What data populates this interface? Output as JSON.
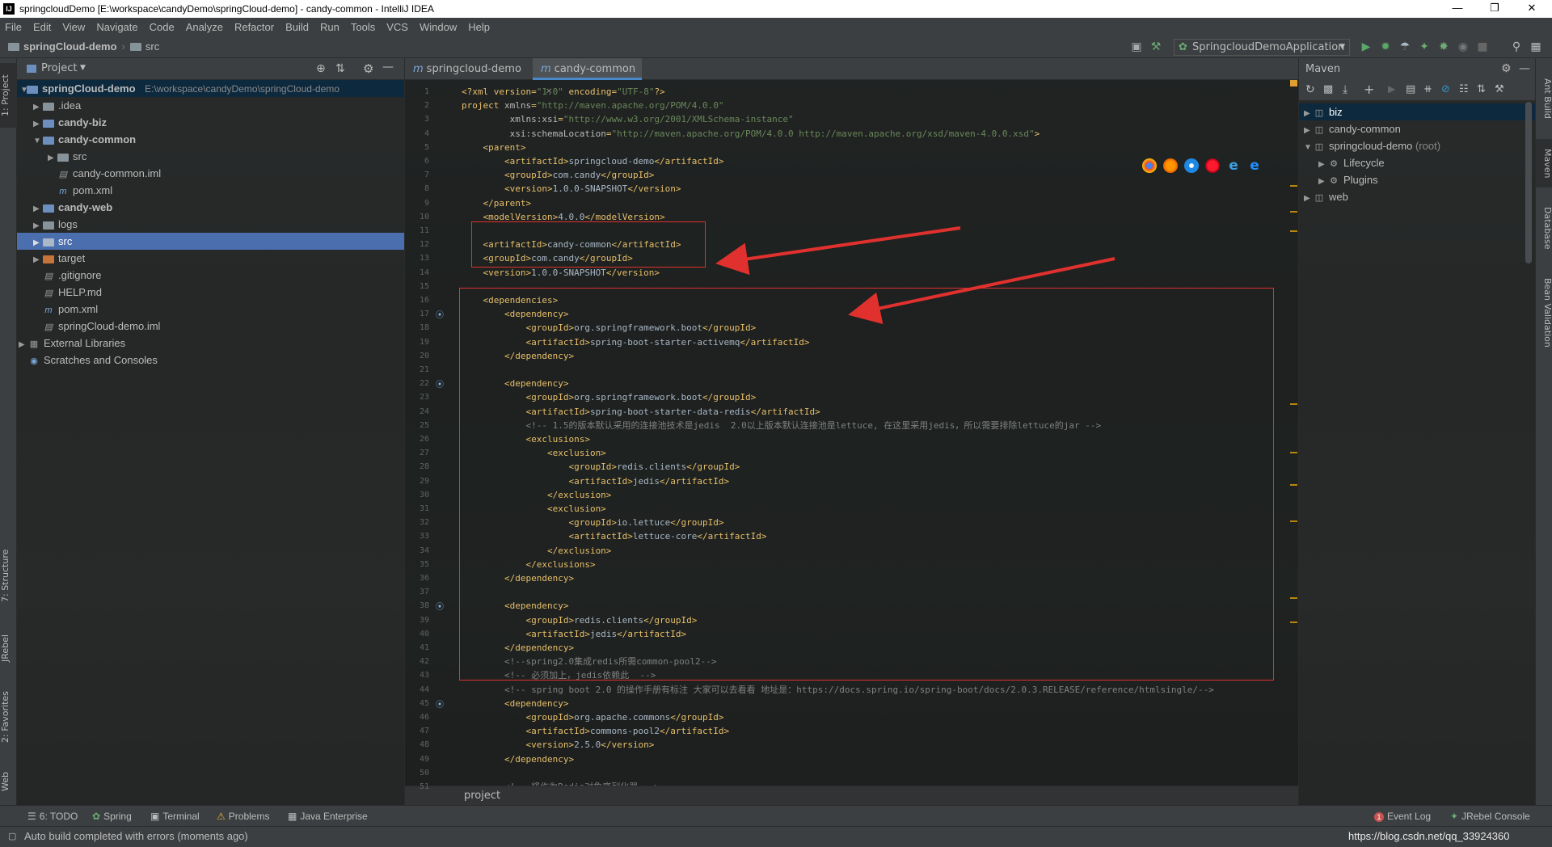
{
  "window": {
    "title": "springcloudDemo [E:\\workspace\\candyDemo\\springCloud-demo] - candy-common - IntelliJ IDEA",
    "app_icon": "IJ"
  },
  "menu": [
    "File",
    "Edit",
    "View",
    "Navigate",
    "Code",
    "Analyze",
    "Refactor",
    "Build",
    "Run",
    "Tools",
    "VCS",
    "Window",
    "Help"
  ],
  "navbar": {
    "root": "springCloud-demo",
    "child": "src",
    "run_config": "SpringcloudDemoApplication"
  },
  "project_panel": {
    "title": "Project",
    "tree": [
      {
        "label": "springCloud-demo",
        "path": "E:\\workspace\\candyDemo\\springCloud-demo",
        "icon": "module-folder-icon",
        "expanded": true
      },
      {
        "label": ".idea",
        "icon": "folder-icon"
      },
      {
        "label": "candy-biz",
        "icon": "module-folder-icon"
      },
      {
        "label": "candy-common",
        "icon": "module-folder-icon",
        "expanded": true
      },
      {
        "label": "src",
        "icon": "folder-icon"
      },
      {
        "label": "candy-common.iml",
        "icon": "iml-file-icon"
      },
      {
        "label": "pom.xml",
        "icon": "maven-file-icon"
      },
      {
        "label": "candy-web",
        "icon": "module-folder-icon"
      },
      {
        "label": "logs",
        "icon": "folder-icon"
      },
      {
        "label": "src",
        "icon": "source-folder-icon",
        "selected": true
      },
      {
        "label": "target",
        "icon": "excluded-folder-icon"
      },
      {
        "label": ".gitignore",
        "icon": "text-file-icon"
      },
      {
        "label": "HELP.md",
        "icon": "markdown-file-icon"
      },
      {
        "label": "pom.xml",
        "icon": "maven-file-icon"
      },
      {
        "label": "springCloud-demo.iml",
        "icon": "iml-file-icon"
      },
      {
        "label": "External Libraries",
        "icon": "library-icon"
      },
      {
        "label": "Scratches and Consoles",
        "icon": "scratch-icon"
      }
    ]
  },
  "editor": {
    "tabs": [
      "springcloud-demo",
      "candy-common"
    ],
    "active_tab": "candy-common",
    "breadcrumb": "project",
    "lines": [
      "<?xml version=\"1.0\" encoding=\"UTF-8\"?>",
      "<project xmlns=\"http://maven.apache.org/POM/4.0.0\"",
      "         xmlns:xsi=\"http://www.w3.org/2001/XMLSchema-instance\"",
      "         xsi:schemaLocation=\"http://maven.apache.org/POM/4.0.0 http://maven.apache.org/xsd/maven-4.0.0.xsd\">",
      "    <parent>",
      "        <artifactId>springcloud-demo</artifactId>",
      "        <groupId>com.candy</groupId>",
      "        <version>1.0.0-SNAPSHOT</version>",
      "    </parent>",
      "    <modelVersion>4.0.0</modelVersion>",
      "",
      "    <artifactId>candy-common</artifactId>",
      "    <groupId>com.candy</groupId>",
      "    <version>1.0.0-SNAPSHOT</version>",
      "",
      "    <dependencies>",
      "        <dependency>",
      "            <groupId>org.springframework.boot</groupId>",
      "            <artifactId>spring-boot-starter-activemq</artifactId>",
      "        </dependency>",
      "",
      "        <dependency>",
      "            <groupId>org.springframework.boot</groupId>",
      "            <artifactId>spring-boot-starter-data-redis</artifactId>",
      "            <!-- 1.5的版本默认采用的连接池技术是jedis  2.0以上版本默认连接池是lettuce, 在这里采用jedis，所以需要排除lettuce的jar -->",
      "            <exclusions>",
      "                <exclusion>",
      "                    <groupId>redis.clients</groupId>",
      "                    <artifactId>jedis</artifactId>",
      "                </exclusion>",
      "                <exclusion>",
      "                    <groupId>io.lettuce</groupId>",
      "                    <artifactId>lettuce-core</artifactId>",
      "                </exclusion>",
      "            </exclusions>",
      "        </dependency>",
      "",
      "        <dependency>",
      "            <groupId>redis.clients</groupId>",
      "            <artifactId>jedis</artifactId>",
      "        </dependency>",
      "        <!--spring2.0集成redis所需common-pool2-->",
      "        <!-- 必须加上，jedis依赖此  -->",
      "        <!-- spring boot 2.0 的操作手册有标注 大家可以去看看 地址是：https://docs.spring.io/spring-boot/docs/2.0.3.RELEASE/reference/htmlsingle/-->",
      "        <dependency>",
      "            <groupId>org.apache.commons</groupId>",
      "            <artifactId>commons-pool2</artifactId>",
      "            <version>2.5.0</version>",
      "        </dependency>",
      "",
      "        <!-- 将作为Redis对象序列化器 -->"
    ]
  },
  "maven_panel": {
    "title": "Maven",
    "tree": [
      {
        "label": "biz",
        "icon": "maven-module-icon",
        "selected": true
      },
      {
        "label": "candy-common",
        "icon": "maven-module-icon"
      },
      {
        "label": "springcloud-demo",
        "suffix": "(root)",
        "icon": "maven-module-icon",
        "expanded": true
      },
      {
        "label": "Lifecycle",
        "icon": "lifecycle-folder-icon"
      },
      {
        "label": "Plugins",
        "icon": "plugins-folder-icon"
      },
      {
        "label": "web",
        "icon": "maven-module-icon"
      }
    ]
  },
  "left_strip": [
    "1: Project",
    "7: Structure",
    "JRebel",
    "2: Favorites",
    "Web"
  ],
  "right_strip": [
    "Ant Build",
    "Maven",
    "Database",
    "Bean Validation"
  ],
  "bottom_tools": [
    "6: TODO",
    "Spring",
    "Terminal",
    "Problems",
    "Java Enterprise"
  ],
  "bottom_right_tools": [
    "Event Log",
    "JRebel Console"
  ],
  "event_log_count": "1",
  "status": {
    "message": "Auto build completed with errors (moments ago)",
    "watermark": "https://blog.csdn.net/qq_33924360"
  },
  "colors": {
    "annotation_red": "#e0312e",
    "selection_blue": "#4b6eaf"
  }
}
